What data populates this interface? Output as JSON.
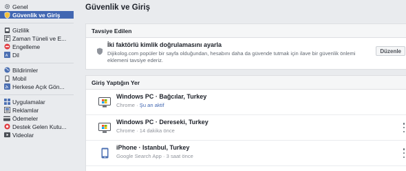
{
  "sidebar": {
    "groups": [
      {
        "items": [
          {
            "label": "Genel",
            "icon": "gear-icon"
          },
          {
            "label": "Güvenlik ve Giriş",
            "icon": "shield-icon",
            "selected": true
          }
        ]
      },
      {
        "items": [
          {
            "label": "Gizlilik",
            "icon": "lock-icon"
          },
          {
            "label": "Zaman Tüneli ve E...",
            "icon": "timeline-icon"
          },
          {
            "label": "Engelleme",
            "icon": "block-icon"
          },
          {
            "label": "Dil",
            "icon": "language-icon"
          }
        ]
      },
      {
        "items": [
          {
            "label": "Bildirimler",
            "icon": "globe-icon"
          },
          {
            "label": "Mobil",
            "icon": "mobile-icon"
          },
          {
            "label": "Herkese Açık Gön...",
            "icon": "rss-icon"
          }
        ]
      },
      {
        "items": [
          {
            "label": "Uygulamalar",
            "icon": "apps-icon"
          },
          {
            "label": "Reklamlar",
            "icon": "ads-icon"
          },
          {
            "label": "Ödemeler",
            "icon": "payment-icon"
          },
          {
            "label": "Destek Gelen Kutu...",
            "icon": "support-inbox-icon"
          },
          {
            "label": "Videolar",
            "icon": "video-icon"
          }
        ]
      }
    ]
  },
  "page": {
    "title": "Güvenlik ve Giriş"
  },
  "recommended": {
    "header": "Tavsiye Edilen",
    "title": "İki faktörlü kimlik doğrulamasını ayarla",
    "description": "Dijikolog.com popüler bir sayfa olduğundan, hesabını daha da güvende tutmak için ilave bir güvenlik önlemi eklemeni tavsiye ederiz.",
    "button_label": "Düzenle"
  },
  "logins": {
    "header": "Giriş Yaptığın Yer",
    "sessions": [
      {
        "device": "Windows PC · Bağcılar, Turkey",
        "app": "Chrome",
        "separator": " · ",
        "time": "Şu an aktif",
        "active": true,
        "icon": "desktop-icon"
      },
      {
        "device": "Windows PC · Dereseki, Turkey",
        "app": "Chrome",
        "separator": " · ",
        "time": "14 dakika önce",
        "active": false,
        "icon": "desktop-icon"
      },
      {
        "device": "iPhone · Istanbul, Turkey",
        "app": "Google Search App",
        "separator": " · ",
        "time": "3 saat önce",
        "active": false,
        "icon": "phone-icon"
      }
    ]
  }
}
